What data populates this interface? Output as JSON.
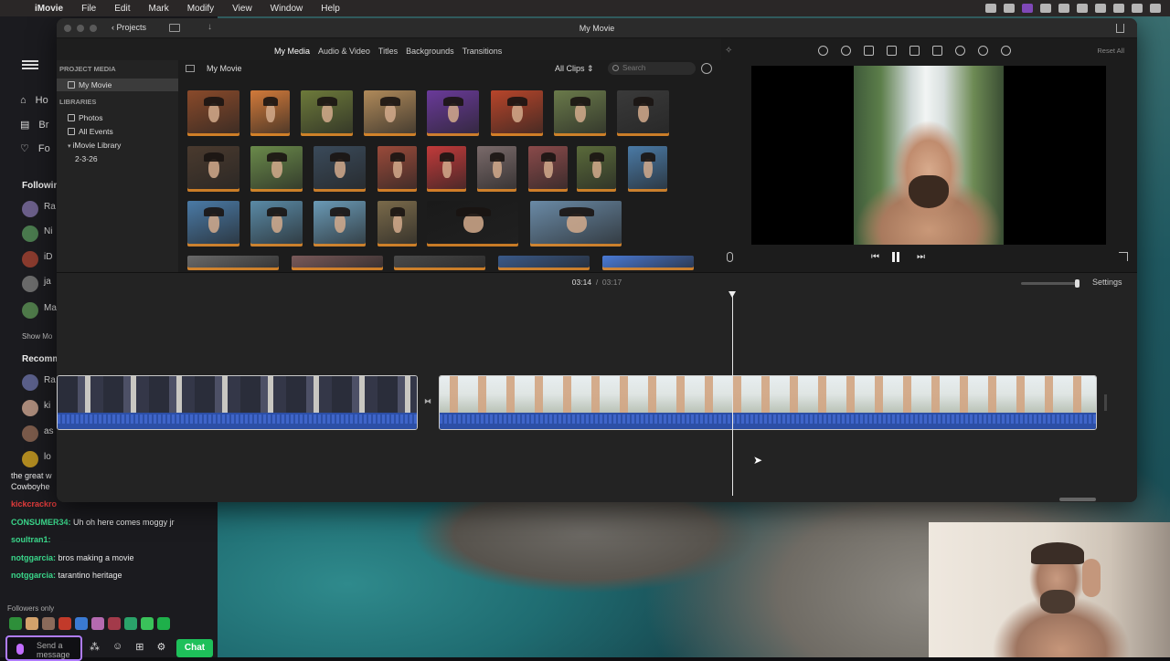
{
  "menubar": {
    "apple": "",
    "items": [
      "iMovie",
      "File",
      "Edit",
      "Mark",
      "Modify",
      "View",
      "Window",
      "Help"
    ]
  },
  "twitch": {
    "nav": [
      "Ho",
      "Br",
      "Fo"
    ],
    "following_header": "Followin",
    "channels": [
      {
        "name": "Ra",
        "color": "#6b5f8a"
      },
      {
        "name": "Ni",
        "color": "#4a7a4e"
      },
      {
        "name": "iD",
        "color": "#8a3b2e"
      },
      {
        "name": "ja",
        "color": "#6a6a6a"
      },
      {
        "name": "Ma",
        "color": "#4f7a4a"
      }
    ],
    "show_more": "Show Mo",
    "recommended_header": "Recomm",
    "rec_channels": [
      {
        "name": "Ra",
        "color": "#5a5f8a"
      },
      {
        "name": "ki",
        "color": "#aa8a7a"
      },
      {
        "name": "as",
        "color": "#7a5a4a"
      },
      {
        "name": "lo",
        "color": "#b08a20"
      }
    ],
    "chat": [
      {
        "user": "the great w",
        "msg": "",
        "cls": "msg"
      },
      {
        "user": "Cowboyhe",
        "msg": "",
        "cls": "msg"
      },
      {
        "user": "kickcrackro",
        "msg": "",
        "cls": "u1"
      },
      {
        "user": "CONSUMER34:",
        "msg": " Uh oh here comes moggy jr",
        "cls": "u2"
      },
      {
        "user": "soultran1:",
        "msg": "",
        "cls": "u2"
      },
      {
        "user": "notggarcia:",
        "msg": " bros making a movie",
        "cls": "u2"
      },
      {
        "user": "notggarcia:",
        "msg": " tarantino heritage",
        "cls": "u2"
      }
    ],
    "followers_only": "Followers only",
    "chat_placeholder": "Send a message",
    "chat_button": "Chat"
  },
  "window": {
    "title": "My Movie",
    "projects_button": "Projects",
    "media_tabs": [
      {
        "label": "My Media",
        "active": true
      },
      {
        "label": "Audio & Video",
        "active": false
      },
      {
        "label": "Titles",
        "active": false
      },
      {
        "label": "Backgrounds",
        "active": false
      },
      {
        "label": "Transitions",
        "active": false
      }
    ],
    "sidebar": {
      "project_media_header": "PROJECT MEDIA",
      "project_item": "My Movie",
      "libraries_header": "LIBRARIES",
      "library_items": [
        "Photos",
        "All Events",
        "iMovie Library",
        "2-3-26"
      ]
    },
    "browser": {
      "title": "My Movie",
      "filter": "All Clips",
      "search_placeholder": "Search"
    },
    "viewer": {
      "reset_all": "Reset All"
    },
    "timeline": {
      "current_time": "03:14",
      "separator": "/",
      "total_time": "03:17",
      "settings": "Settings"
    }
  }
}
